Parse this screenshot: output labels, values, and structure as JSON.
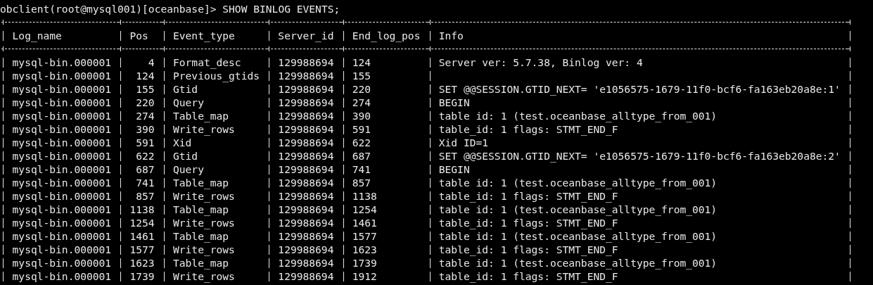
{
  "command_line": "obclient(root@mysql001)[oceanbase]> SHOW BINLOG EVENTS;",
  "table": {
    "columns": [
      {
        "label": "Log_name"
      },
      {
        "label": "Pos",
        "right_aligned": true
      },
      {
        "label": "Event_type"
      },
      {
        "label": "Server_id"
      },
      {
        "label": "End_log_pos"
      },
      {
        "label": "Info"
      }
    ],
    "rows": [
      [
        "mysql-bin.000001",
        "4",
        "Format_desc",
        "129988694",
        "124",
        "Server ver: 5.7.38, Binlog ver: 4"
      ],
      [
        "mysql-bin.000001",
        "124",
        "Previous_gtids",
        "129988694",
        "155"
      ],
      [
        "mysql-bin.000001",
        "155",
        "Gtid",
        "129988694",
        "220",
        "SET @@SESSION.GTID_NEXT= 'e1056575-1679-11f0-bcf6-fa163eb20a8e:1'"
      ],
      [
        "mysql-bin.000001",
        "220",
        "Query",
        "129988694",
        "274",
        "BEGIN"
      ],
      [
        "mysql-bin.000001",
        "274",
        "Table_map",
        "129988694",
        "390",
        "table id: 1 (test.oceanbase_alltype_from_001)"
      ],
      [
        "mysql-bin.000001",
        "390",
        "Write_rows",
        "129988694",
        "591",
        "table_id: 1 flags: STMT_END_F"
      ],
      [
        "mysql-bin.000001",
        "591",
        "Xid",
        "129988694",
        "622",
        "Xid ID=1"
      ],
      [
        "mysql-bin.000001",
        "622",
        "Gtid",
        "129988694",
        "687",
        "SET @@SESSION.GTID_NEXT= 'e1056575-1679-11f0-bcf6-fa163eb20a8e:2'"
      ],
      [
        "mysql-bin.000001",
        "687",
        "Query",
        "129988694",
        "741",
        "BEGIN"
      ],
      [
        "mysql-bin.000001",
        "741",
        "Table_map",
        "129988694",
        "857",
        "table id: 1 (test.oceanbase_alltype_from_001)"
      ],
      [
        "mysql-bin.000001",
        "857",
        "Write_rows",
        "129988694",
        "1138",
        "table_id: 1 flags: STMT_END_F"
      ],
      [
        "mysql-bin.000001",
        "1138",
        "Table_map",
        "129988694",
        "1254",
        "table id: 1 (test.oceanbase_alltype_from_001)"
      ],
      [
        "mysql-bin.000001",
        "1254",
        "Write_rows",
        "129988694",
        "1461",
        "table_id: 1 flags: STMT_END_F"
      ],
      [
        "mysql-bin.000001",
        "1461",
        "Table_map",
        "129988694",
        "1577",
        "table id: 1 (test.oceanbase_alltype_from_001)"
      ],
      [
        "mysql-bin.000001",
        "1577",
        "Write_rows",
        "129988694",
        "1623",
        "table_id: 1 flags: STMT_END_F"
      ],
      [
        "mysql-bin.000001",
        "1623",
        "Table_map",
        "129988694",
        "1739",
        "table id: 1 (test.oceanbase_alltype_from_001)"
      ],
      [
        "mysql-bin.000001",
        "1739",
        "Write_rows",
        "129988694",
        "1912",
        "table_id: 1 flags: STMT_END_F"
      ]
    ]
  }
}
